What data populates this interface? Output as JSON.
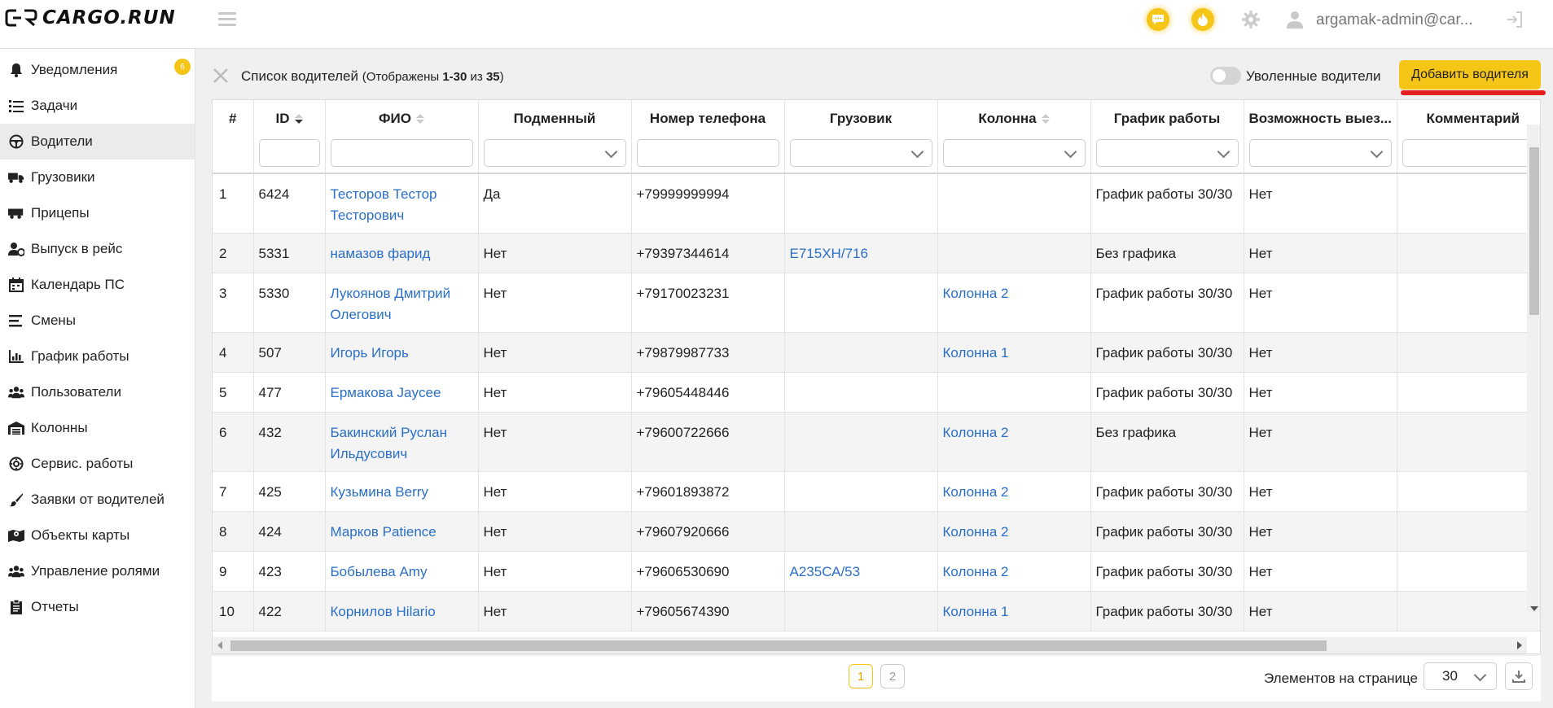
{
  "app": {
    "logo_text": "CARGO.RUN"
  },
  "header": {
    "user_name": "argamak-admin@car..."
  },
  "sidebar": {
    "badge": "6",
    "items": [
      {
        "label": "Уведомления",
        "icon": "bell-icon"
      },
      {
        "label": "Задачи",
        "icon": "tasks-icon"
      },
      {
        "label": "Водители",
        "icon": "steering-wheel-icon"
      },
      {
        "label": "Грузовики",
        "icon": "truck-icon"
      },
      {
        "label": "Прицепы",
        "icon": "trailer-icon"
      },
      {
        "label": "Выпуск в рейс",
        "icon": "driver-release-icon"
      },
      {
        "label": "Календарь ПС",
        "icon": "calendar-icon"
      },
      {
        "label": "Смены",
        "icon": "shifts-icon"
      },
      {
        "label": "График работы",
        "icon": "bar-chart-icon"
      },
      {
        "label": "Пользователи",
        "icon": "users-icon"
      },
      {
        "label": "Колонны",
        "icon": "warehouse-icon"
      },
      {
        "label": "Сервис. работы",
        "icon": "service-icon"
      },
      {
        "label": "Заявки от водителей",
        "icon": "brush-icon"
      },
      {
        "label": "Объекты карты",
        "icon": "map-icon"
      },
      {
        "label": "Управление ролями",
        "icon": "roles-icon"
      },
      {
        "label": "Отчеты",
        "icon": "report-icon"
      }
    ]
  },
  "toolbar": {
    "title": "Список водителей",
    "shown_prefix": "(Отображены ",
    "shown_range": "1-30",
    "shown_of": " из ",
    "shown_total": "35",
    "shown_suffix": ")",
    "fired_toggle_label": "Уволенные водители",
    "add_button": "Добавить водителя"
  },
  "table": {
    "columns": [
      "#",
      "ID",
      "ФИО",
      "Подменный",
      "Номер телефона",
      "Грузовик",
      "Колонна",
      "График работы",
      "Возможность выез...",
      "Комментарий"
    ],
    "rows": [
      [
        "1",
        "6424",
        "Тесторов Тестор Тесторович",
        "Да",
        "+79999999994",
        "",
        "",
        "График работы 30/30",
        "Нет",
        ""
      ],
      [
        "2",
        "5331",
        "намазов фарид",
        "Нет",
        "+79397344614",
        "Е715ХН/716",
        "",
        "Без графика",
        "Нет",
        ""
      ],
      [
        "3",
        "5330",
        "Лукоянов Дмитрий Олегович",
        "Нет",
        "+79170023231",
        "",
        "Колонна 2",
        "График работы 30/30",
        "Нет",
        ""
      ],
      [
        "4",
        "507",
        "Игорь Игорь",
        "Нет",
        "+79879987733",
        "",
        "Колонна 1",
        "График работы 30/30",
        "Нет",
        ""
      ],
      [
        "5",
        "477",
        "Ермакова Jaycee",
        "Нет",
        "+79605448446",
        "",
        "",
        "График работы 30/30",
        "Нет",
        ""
      ],
      [
        "6",
        "432",
        "Бакинский Руслан Ильдусович",
        "Нет",
        "+79600722666",
        "",
        "Колонна 2",
        "Без графика",
        "Нет",
        ""
      ],
      [
        "7",
        "425",
        "Кузьмина Berry",
        "Нет",
        "+79601893872",
        "",
        "Колонна 2",
        "График работы 30/30",
        "Нет",
        ""
      ],
      [
        "8",
        "424",
        "Марков Patience",
        "Нет",
        "+79607920666",
        "",
        "Колонна 2",
        "График работы 30/30",
        "Нет",
        ""
      ],
      [
        "9",
        "423",
        "Бобылева Amy",
        "Нет",
        "+79606530690",
        "А235СА/53",
        "Колонна 2",
        "График работы 30/30",
        "Нет",
        ""
      ],
      [
        "10",
        "422",
        "Корнилов Hilario",
        "Нет",
        "+79605674390",
        "",
        "Колонна 1",
        "График работы 30/30",
        "Нет",
        ""
      ]
    ]
  },
  "pagination": {
    "pages": [
      "1",
      "2"
    ],
    "current": "1",
    "per_page_label": "Элементов на странице",
    "per_page_value": "30"
  },
  "colors": {
    "accent": "#f5c518",
    "link": "#2a6fc7",
    "highlight": "#e41e1e"
  }
}
